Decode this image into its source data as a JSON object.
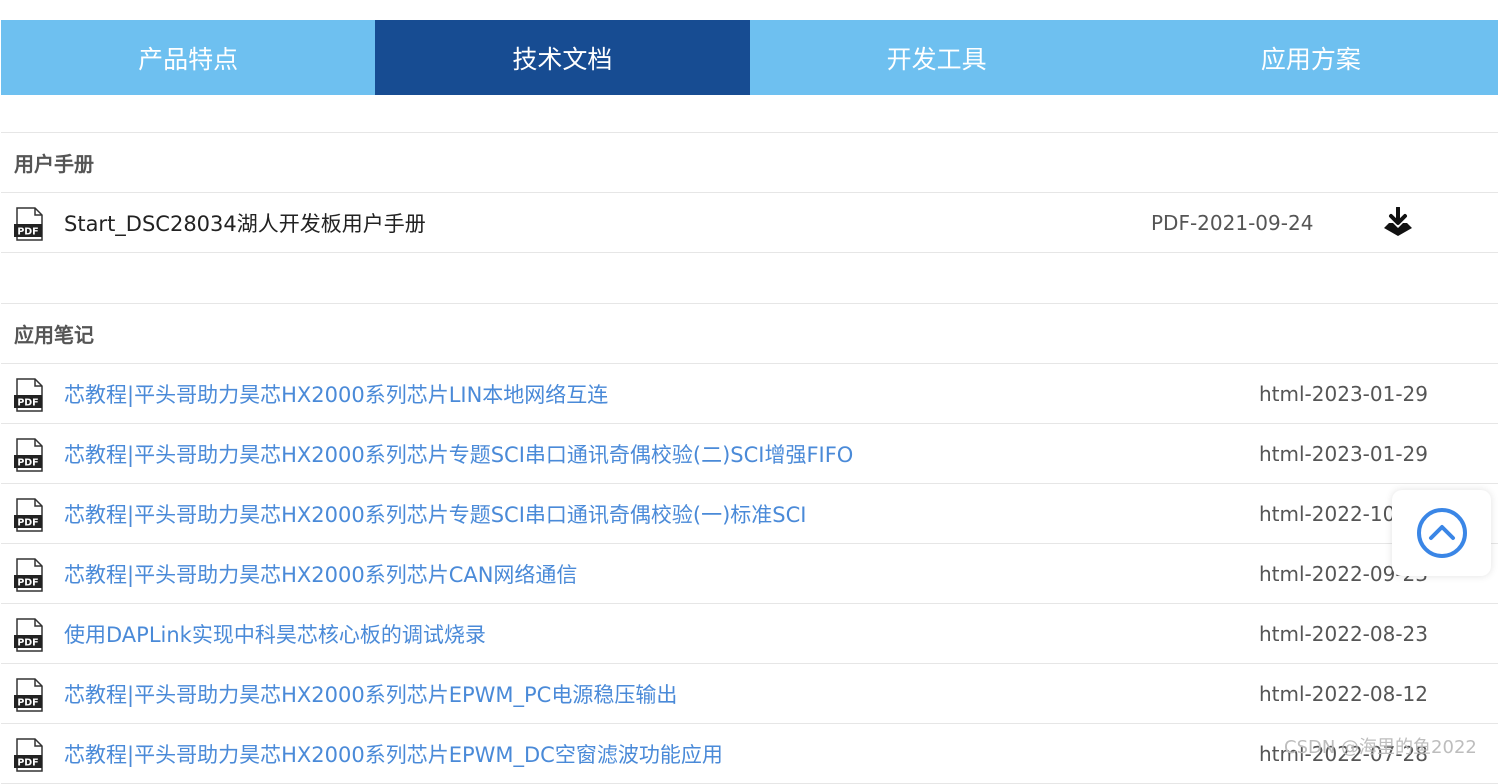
{
  "tabs": [
    {
      "label": "产品特点",
      "active": false
    },
    {
      "label": "技术文档",
      "active": true
    },
    {
      "label": "开发工具",
      "active": false
    },
    {
      "label": "应用方案",
      "active": false
    }
  ],
  "manuals": {
    "heading": "用户手册",
    "items": [
      {
        "title": "Start_DSC28034湖人开发板用户手册",
        "meta": "PDF-2021-09-24"
      }
    ]
  },
  "notes": {
    "heading": "应用笔记",
    "items": [
      {
        "title": "芯教程|平头哥助力昊芯HX2000系列芯片LIN本地网络互连",
        "meta": "html-2023-01-29"
      },
      {
        "title": "芯教程|平头哥助力昊芯HX2000系列芯片专题SCI串口通讯奇偶校验(二)SCI增强FIFO",
        "meta": "html-2023-01-29"
      },
      {
        "title": "芯教程|平头哥助力昊芯HX2000系列芯片专题SCI串口通讯奇偶校验(一)标准SCI",
        "meta": "html-2022-10"
      },
      {
        "title": "芯教程|平头哥助力昊芯HX2000系列芯片CAN网络通信",
        "meta": "html-2022-09-23"
      },
      {
        "title": "使用DAPLink实现中科昊芯核心板的调试烧录",
        "meta": "html-2022-08-23"
      },
      {
        "title": "芯教程|平头哥助力昊芯HX2000系列芯片EPWM_PC电源稳压输出",
        "meta": "html-2022-08-12"
      },
      {
        "title": "芯教程|平头哥助力昊芯HX2000系列芯片EPWM_DC空窗滤波功能应用",
        "meta": "html-2022-07-28"
      }
    ]
  },
  "icons": {
    "file": "pdf-icon",
    "download": "download-icon",
    "back_to_top": "chevron-up-circle-icon",
    "pdf_text": "PDF"
  },
  "watermark": "CSDN @海里的鱼2022",
  "colors": {
    "tab_bg": "#6ec0f0",
    "tab_active_bg": "#174c92",
    "link": "#4a8ad8",
    "back_top_accent": "#3a86e6"
  }
}
